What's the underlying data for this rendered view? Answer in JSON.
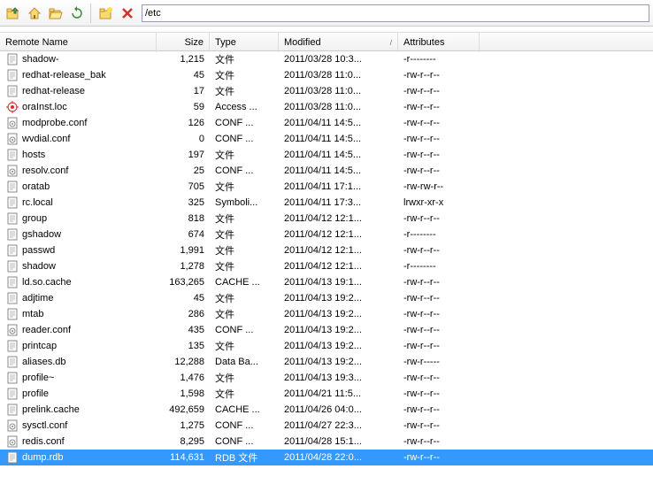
{
  "toolbar": {
    "path": "/etc"
  },
  "columns": {
    "name": "Remote Name",
    "size": "Size",
    "type": "Type",
    "modified": "Modified",
    "attributes": "Attributes"
  },
  "files": [
    {
      "icon": "doc",
      "name": "shadow-",
      "size": "1,215",
      "type": "文件",
      "mod": "2011/03/28 10:3...",
      "attr": "-r--------"
    },
    {
      "icon": "doc",
      "name": "redhat-release_bak",
      "size": "45",
      "type": "文件",
      "mod": "2011/03/28 11:0...",
      "attr": "-rw-r--r--"
    },
    {
      "icon": "doc",
      "name": "redhat-release",
      "size": "17",
      "type": "文件",
      "mod": "2011/03/28 11:0...",
      "attr": "-rw-r--r--"
    },
    {
      "icon": "loc",
      "name": "oraInst.loc",
      "size": "59",
      "type": "Access ...",
      "mod": "2011/03/28 11:0...",
      "attr": "-rw-r--r--"
    },
    {
      "icon": "conf",
      "name": "modprobe.conf",
      "size": "126",
      "type": "CONF ...",
      "mod": "2011/04/11 14:5...",
      "attr": "-rw-r--r--"
    },
    {
      "icon": "conf",
      "name": "wvdial.conf",
      "size": "0",
      "type": "CONF ...",
      "mod": "2011/04/11 14:5...",
      "attr": "-rw-r--r--"
    },
    {
      "icon": "doc",
      "name": "hosts",
      "size": "197",
      "type": "文件",
      "mod": "2011/04/11 14:5...",
      "attr": "-rw-r--r--"
    },
    {
      "icon": "conf",
      "name": "resolv.conf",
      "size": "25",
      "type": "CONF ...",
      "mod": "2011/04/11 14:5...",
      "attr": "-rw-r--r--"
    },
    {
      "icon": "doc",
      "name": "oratab",
      "size": "705",
      "type": "文件",
      "mod": "2011/04/11 17:1...",
      "attr": "-rw-rw-r--"
    },
    {
      "icon": "doc",
      "name": "rc.local",
      "size": "325",
      "type": "Symboli...",
      "mod": "2011/04/11 17:3...",
      "attr": "lrwxr-xr-x"
    },
    {
      "icon": "doc",
      "name": "group",
      "size": "818",
      "type": "文件",
      "mod": "2011/04/12 12:1...",
      "attr": "-rw-r--r--"
    },
    {
      "icon": "doc",
      "name": "gshadow",
      "size": "674",
      "type": "文件",
      "mod": "2011/04/12 12:1...",
      "attr": "-r--------"
    },
    {
      "icon": "doc",
      "name": "passwd",
      "size": "1,991",
      "type": "文件",
      "mod": "2011/04/12 12:1...",
      "attr": "-rw-r--r--"
    },
    {
      "icon": "doc",
      "name": "shadow",
      "size": "1,278",
      "type": "文件",
      "mod": "2011/04/12 12:1...",
      "attr": "-r--------"
    },
    {
      "icon": "doc",
      "name": "ld.so.cache",
      "size": "163,265",
      "type": "CACHE ...",
      "mod": "2011/04/13 19:1...",
      "attr": "-rw-r--r--"
    },
    {
      "icon": "doc",
      "name": "adjtime",
      "size": "45",
      "type": "文件",
      "mod": "2011/04/13 19:2...",
      "attr": "-rw-r--r--"
    },
    {
      "icon": "doc",
      "name": "mtab",
      "size": "286",
      "type": "文件",
      "mod": "2011/04/13 19:2...",
      "attr": "-rw-r--r--"
    },
    {
      "icon": "conf",
      "name": "reader.conf",
      "size": "435",
      "type": "CONF ...",
      "mod": "2011/04/13 19:2...",
      "attr": "-rw-r--r--"
    },
    {
      "icon": "doc",
      "name": "printcap",
      "size": "135",
      "type": "文件",
      "mod": "2011/04/13 19:2...",
      "attr": "-rw-r--r--"
    },
    {
      "icon": "doc",
      "name": "aliases.db",
      "size": "12,288",
      "type": "Data Ba...",
      "mod": "2011/04/13 19:2...",
      "attr": "-rw-r-----"
    },
    {
      "icon": "doc",
      "name": "profile~",
      "size": "1,476",
      "type": "文件",
      "mod": "2011/04/13 19:3...",
      "attr": "-rw-r--r--"
    },
    {
      "icon": "doc",
      "name": "profile",
      "size": "1,598",
      "type": "文件",
      "mod": "2011/04/21 11:5...",
      "attr": "-rw-r--r--"
    },
    {
      "icon": "doc",
      "name": "prelink.cache",
      "size": "492,659",
      "type": "CACHE ...",
      "mod": "2011/04/26 04:0...",
      "attr": "-rw-r--r--"
    },
    {
      "icon": "conf",
      "name": "sysctl.conf",
      "size": "1,275",
      "type": "CONF ...",
      "mod": "2011/04/27 22:3...",
      "attr": "-rw-r--r--"
    },
    {
      "icon": "conf",
      "name": "redis.conf",
      "size": "8,295",
      "type": "CONF ...",
      "mod": "2011/04/28 15:1...",
      "attr": "-rw-r--r--"
    },
    {
      "icon": "doc",
      "name": "dump.rdb",
      "size": "114,631",
      "type": "RDB 文件",
      "mod": "2011/04/28 22:0...",
      "attr": "-rw-r--r--",
      "selected": true
    }
  ]
}
